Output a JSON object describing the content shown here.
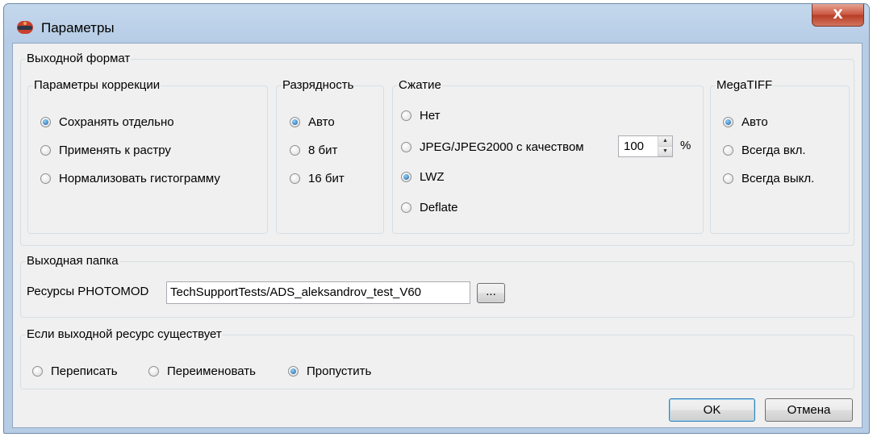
{
  "window": {
    "title": "Параметры",
    "close_glyph": "X"
  },
  "output_format": {
    "title": "Выходной формат",
    "correction": {
      "title": "Параметры коррекции",
      "options": [
        "Сохранять отдельно",
        "Применять к растру",
        "Нормализовать гистограмму"
      ],
      "selected": "Сохранять отдельно"
    },
    "bit_depth": {
      "title": "Разрядность",
      "options": [
        "Авто",
        "8 бит",
        "16 бит"
      ],
      "selected": "Авто"
    },
    "compression": {
      "title": "Сжатие",
      "options": [
        "Нет",
        "JPEG/JPEG2000 с качеством",
        "LWZ",
        "Deflate"
      ],
      "selected": "LWZ",
      "quality_value": "100",
      "quality_unit": "%"
    },
    "megatiff": {
      "title": "MegaTIFF",
      "options": [
        "Авто",
        "Всегда вкл.",
        "Всегда выкл."
      ],
      "selected": "Авто"
    }
  },
  "output_folder": {
    "title": "Выходная папка",
    "label": "Ресурсы PHOTOMOD",
    "path": "TechSupportTests/ADS_aleksandrov_test_V60",
    "browse_label": "..."
  },
  "if_exists": {
    "title": "Если выходной ресурс существует",
    "options": [
      "Переписать",
      "Переименовать",
      "Пропустить"
    ],
    "selected": "Пропустить"
  },
  "buttons": {
    "ok": "OK",
    "cancel": "Отмена"
  },
  "icons": {
    "app": "photomod-glasses-icon",
    "close": "close-icon",
    "spin_up": "spin-up-icon",
    "spin_down": "spin-down-icon"
  }
}
